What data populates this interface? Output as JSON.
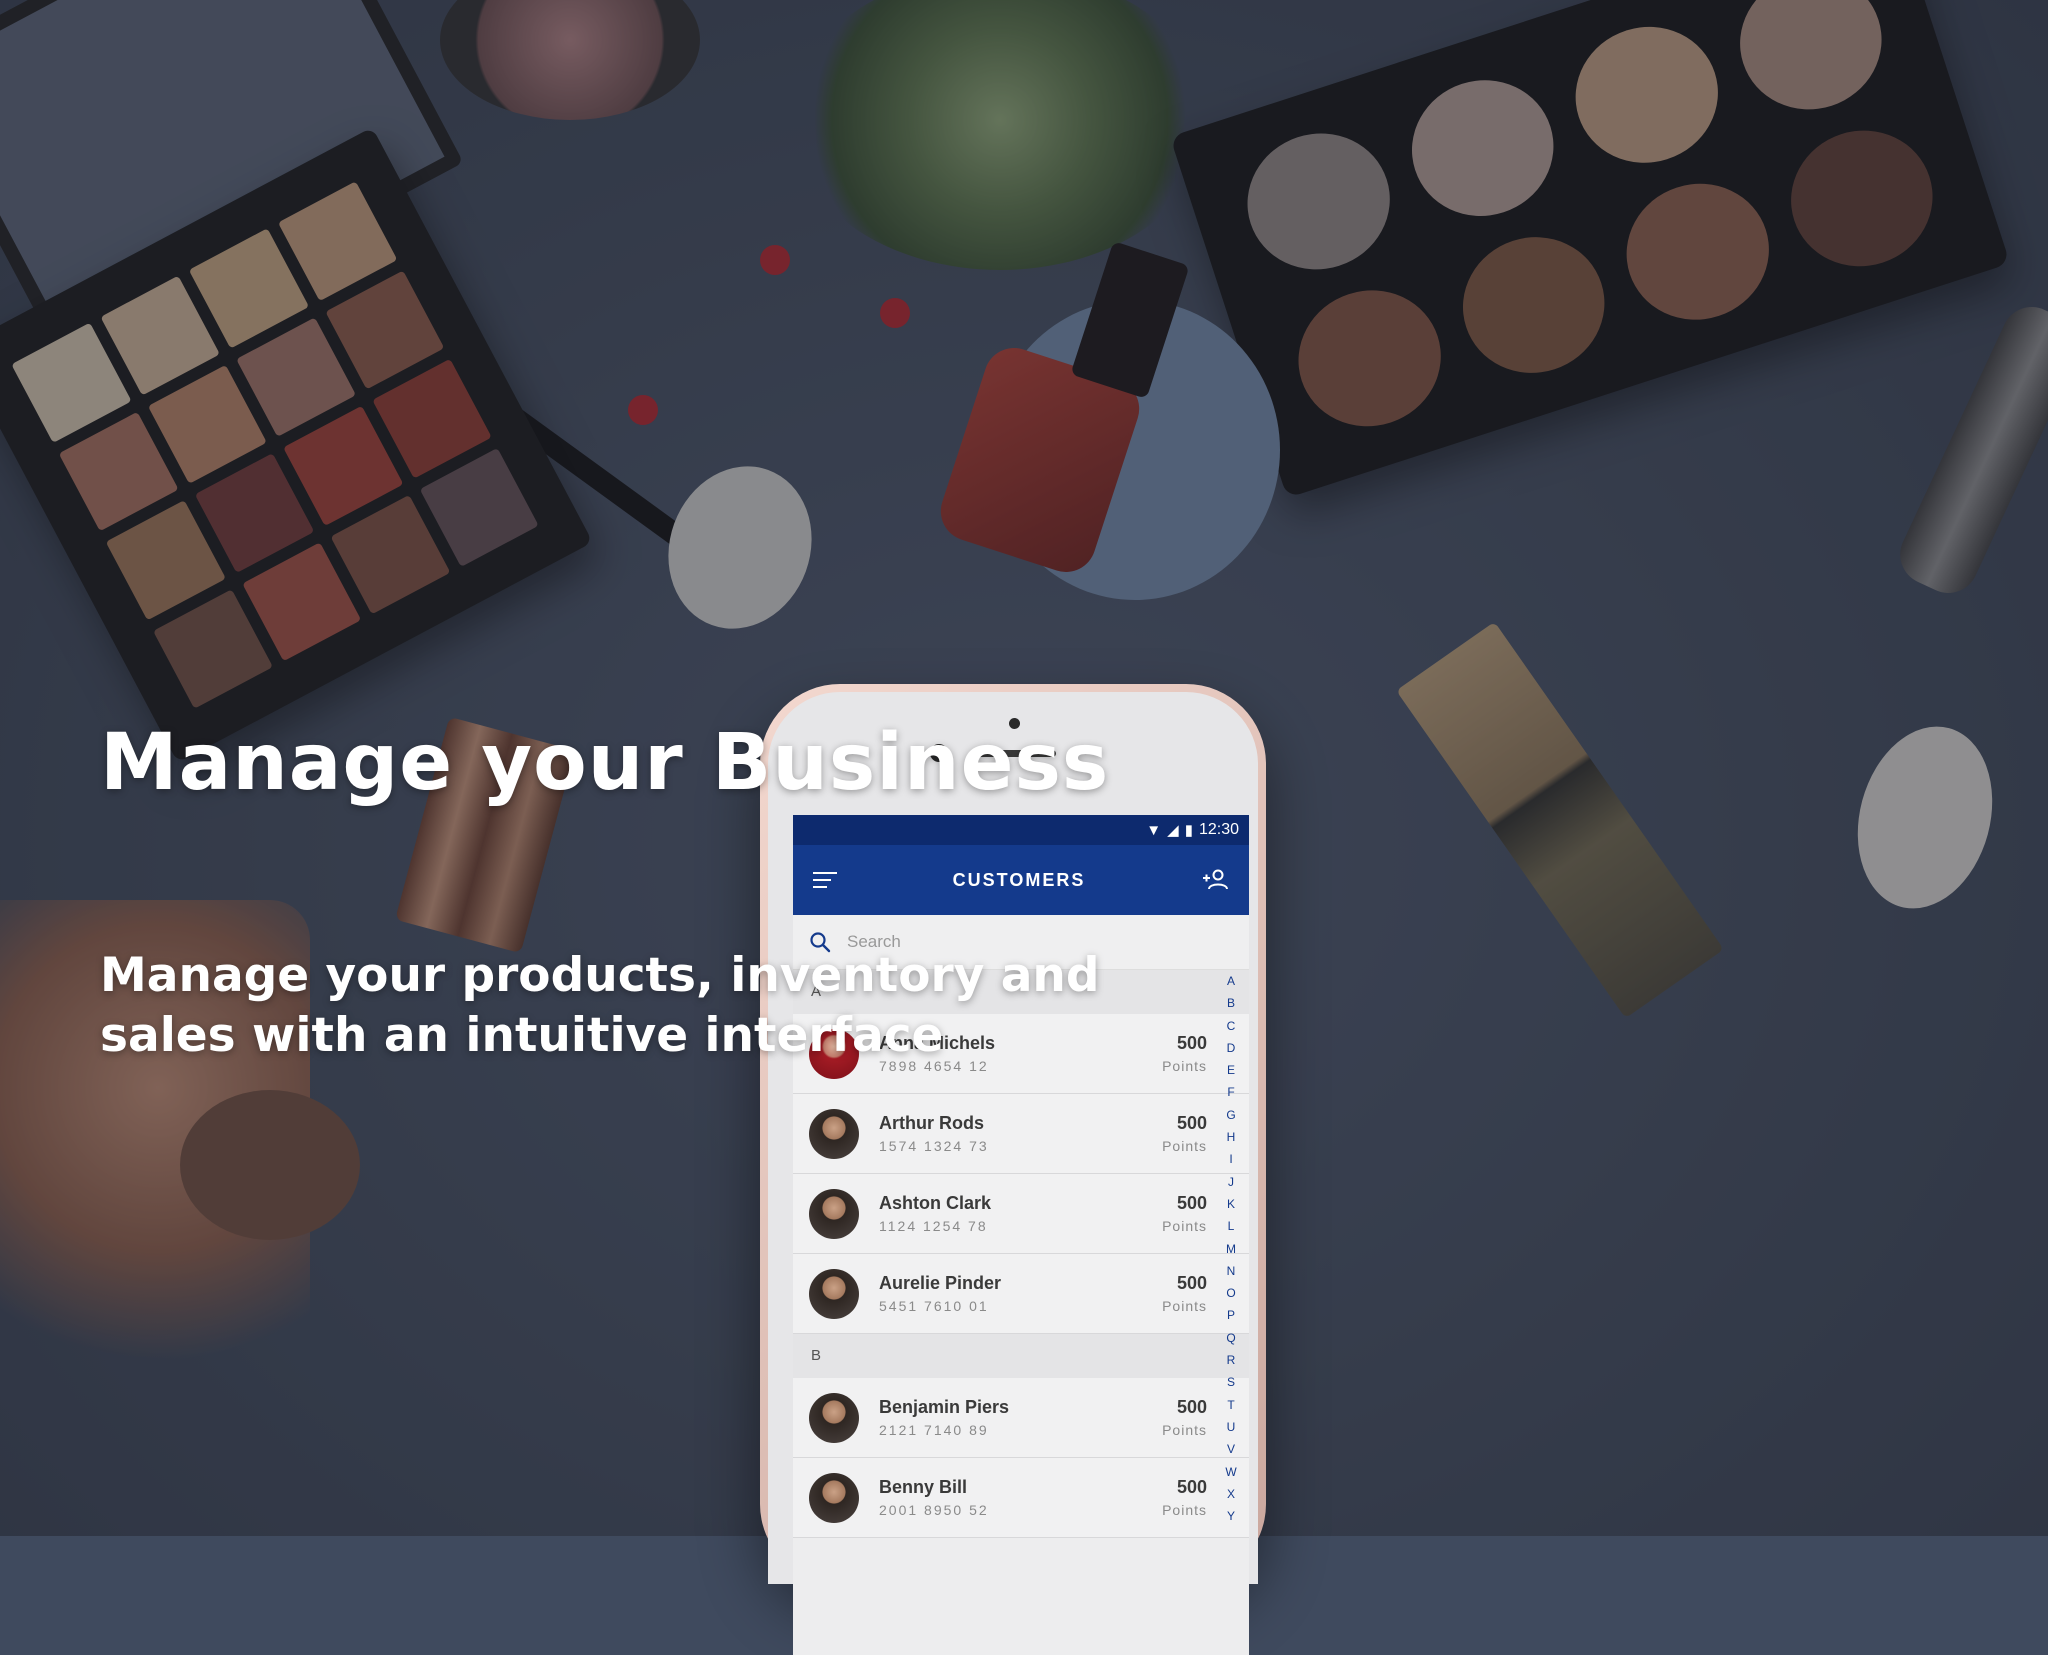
{
  "hero": {
    "title": "Manage your Business",
    "subtitle": "Manage your products, inventory and sales with an intuitive interface"
  },
  "phone": {
    "status_bar": {
      "time": "12:30"
    },
    "app_bar": {
      "title": "CUSTOMERS"
    },
    "search": {
      "placeholder": "Search"
    },
    "sections": [
      {
        "letter": "A",
        "customers": [
          {
            "name": "Anna Michels",
            "phone": "7898 4654 12",
            "points": "500",
            "points_label": "Points"
          },
          {
            "name": "Arthur Rods",
            "phone": "1574 1324 73",
            "points": "500",
            "points_label": "Points"
          },
          {
            "name": "Ashton Clark",
            "phone": "1124 1254 78",
            "points": "500",
            "points_label": "Points"
          },
          {
            "name": "Aurelie Pinder",
            "phone": "5451 7610 01",
            "points": "500",
            "points_label": "Points"
          }
        ]
      },
      {
        "letter": "B",
        "customers": [
          {
            "name": "Benjamin Piers",
            "phone": "2121 7140 89",
            "points": "500",
            "points_label": "Points"
          },
          {
            "name": "Benny Bill",
            "phone": "2001 8950 52",
            "points": "500",
            "points_label": "Points"
          }
        ]
      }
    ],
    "alphabet": [
      "A",
      "B",
      "C",
      "D",
      "E",
      "F",
      "G",
      "H",
      "I",
      "J",
      "K",
      "L",
      "M",
      "N",
      "O",
      "P",
      "Q",
      "R",
      "S",
      "T",
      "U",
      "V",
      "W",
      "X",
      "Y"
    ]
  },
  "colors": {
    "status_bar": "#0d2a6e",
    "app_bar": "#143a8c",
    "accent": "#143a8c",
    "background": "#3f4a5e",
    "phone_body": "#f3d8cf"
  },
  "icons": {
    "menu": "menu-icon",
    "add_user": "add-user-icon",
    "search": "search-icon",
    "wifi": "wifi-icon",
    "signal": "signal-icon",
    "battery": "battery-icon"
  }
}
